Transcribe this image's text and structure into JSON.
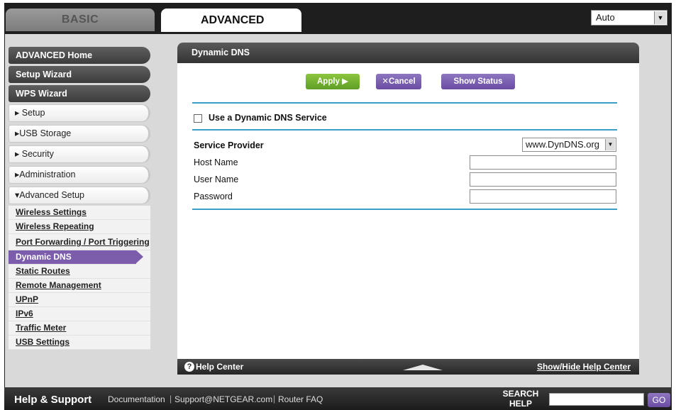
{
  "tabs": {
    "basic": "BASIC",
    "advanced": "ADVANCED"
  },
  "language": {
    "selected": "Auto"
  },
  "sidebar": {
    "top_items": [
      "ADVANCED Home",
      "Setup Wizard",
      "WPS Wizard"
    ],
    "sections": [
      "▸ Setup",
      "▸USB Storage",
      "▸ Security",
      "▸Administration",
      "▾Advanced Setup"
    ],
    "sub_items": [
      "Wireless Settings",
      "Wireless Repeating",
      "Port Forwarding / Port Triggering",
      "Dynamic DNS",
      "Static Routes",
      "Remote Management",
      "UPnP",
      "IPv6",
      "Traffic Meter",
      "USB Settings"
    ]
  },
  "panel": {
    "title": "Dynamic DNS",
    "buttons": {
      "apply": "Apply ▶",
      "cancel": "Cancel",
      "show_status": "Show Status"
    },
    "use_ddns_label": "Use a Dynamic DNS Service",
    "service_provider_label": "Service Provider",
    "service_provider_value": "www.DynDNS.org",
    "host_name_label": "Host Name",
    "host_name_value": "",
    "user_name_label": "User Name",
    "user_name_value": "",
    "password_label": "Password",
    "password_value": "",
    "help_center": "Help Center",
    "show_hide_help": "Show/Hide Help Center"
  },
  "footer": {
    "help_support": "Help & Support",
    "documentation": "Documentation",
    "support_email": "Support@NETGEAR.com",
    "router_faq": "Router FAQ",
    "search_label": "SEARCH HELP",
    "go": "GO"
  },
  "colors": {
    "accent_purple": "#7b5dac",
    "apply_green": "#6aaa2e",
    "rule_blue": "#3a9ec7"
  }
}
